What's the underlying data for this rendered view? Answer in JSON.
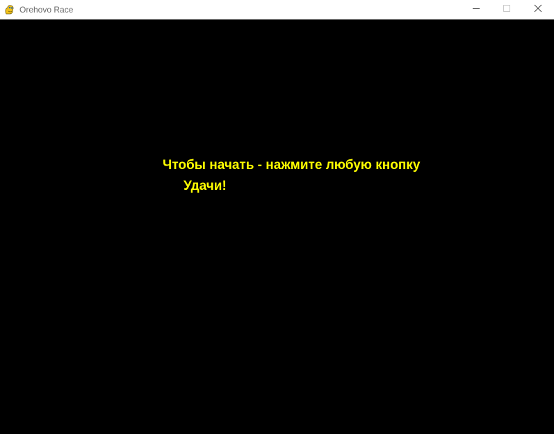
{
  "window": {
    "title": "Orehovo Race",
    "app_icon": "pygame-snake-icon",
    "controls": {
      "minimize_icon": "minimize-icon",
      "maximize_icon": "maximize-icon",
      "close_icon": "close-icon"
    }
  },
  "game": {
    "background_color": "#000000",
    "text_color": "#ffff00",
    "start_message": "Чтобы начать - нажмите любую кнопку",
    "luck_message": "Удачи!"
  }
}
